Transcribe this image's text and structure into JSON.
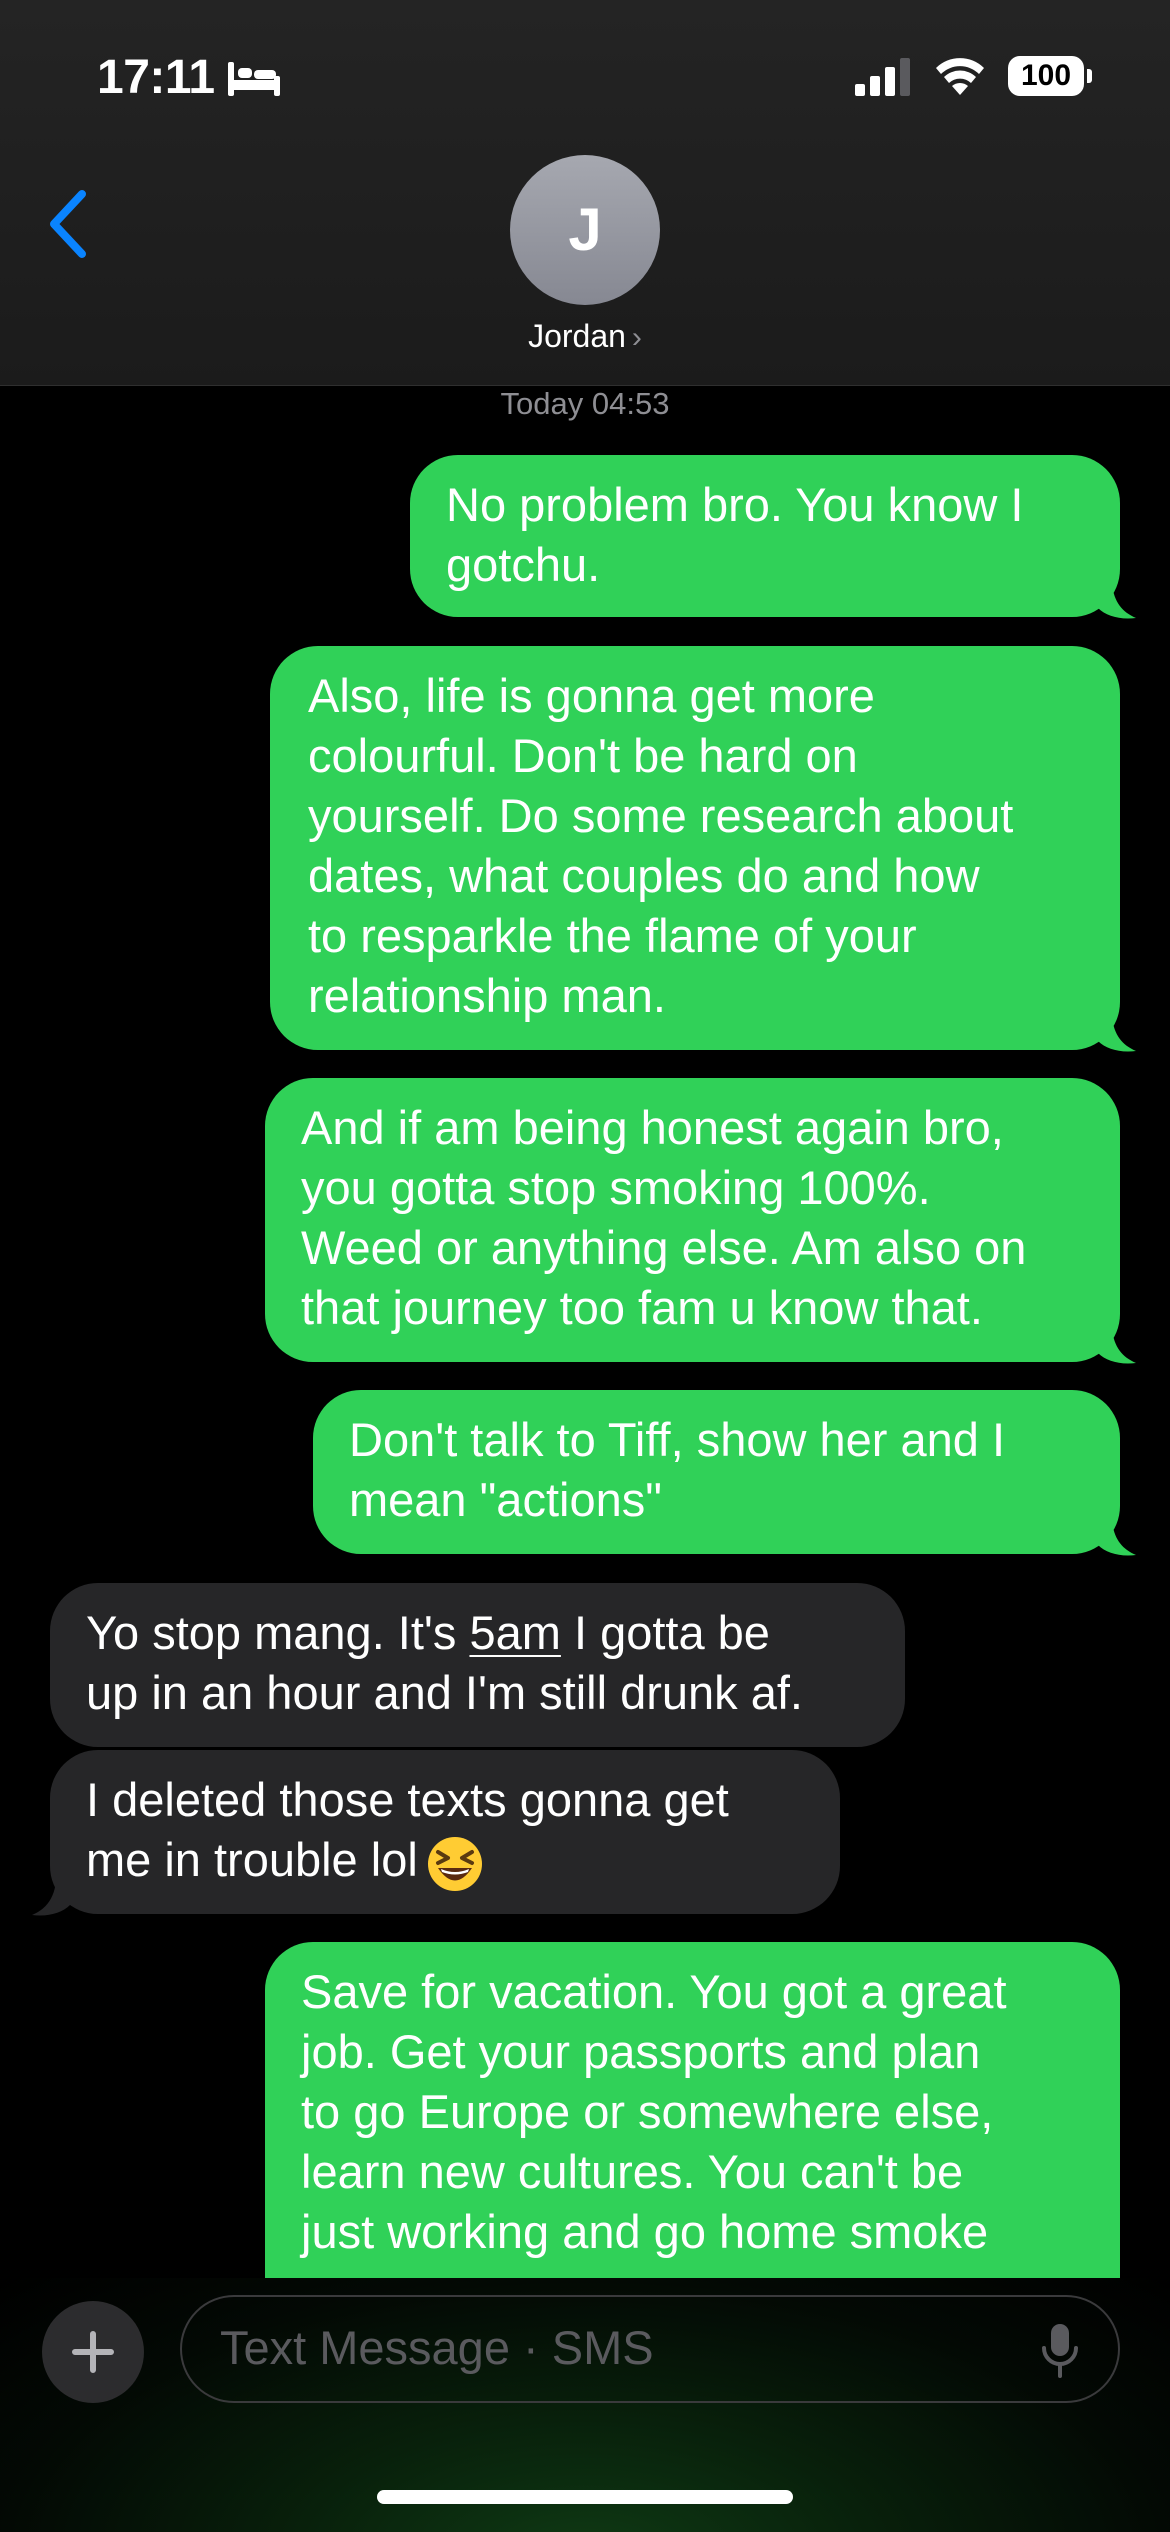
{
  "status_bar": {
    "time": "17:11",
    "battery": "100",
    "icons": [
      "bed-icon",
      "signal-icon",
      "wifi-icon",
      "battery-icon"
    ]
  },
  "header": {
    "avatar_initial": "J",
    "contact_name": "Jordan",
    "chevron": "›",
    "back_icon": "chevron-left-icon"
  },
  "conversation": {
    "timestamp": "Today 04:53",
    "messages": [
      {
        "direction": "outgoing",
        "lines": [
          "No problem bro. You know I",
          "gotchu."
        ]
      },
      {
        "direction": "outgoing",
        "lines": [
          "Also, life is gonna get more",
          "colourful. Don't be hard on",
          "yourself. Do some research about",
          "dates, what couples do and how",
          "to resparkle the flame of your",
          "relationship man."
        ]
      },
      {
        "direction": "outgoing",
        "lines": [
          "And if am being honest again bro,",
          "you gotta stop smoking 100%.",
          "Weed or anything else. Am also on",
          "that journey too fam u know that."
        ]
      },
      {
        "direction": "outgoing",
        "lines": [
          "Don't talk to Tiff, show her and I",
          "mean \"actions\""
        ]
      },
      {
        "direction": "incoming",
        "line1_before": "Yo stop mang. It's ",
        "line1_link": "5am",
        "line1_after": " I gotta be",
        "line2": "up in an hour and I'm still drunk af."
      },
      {
        "direction": "incoming",
        "lines": [
          "I deleted those texts gonna get",
          "me in trouble lol"
        ],
        "emoji": "grinning-squinting-face-emoji"
      },
      {
        "direction": "outgoing",
        "lines": [
          "Save for vacation. You got a great",
          "job.  Get your passports and plan",
          "to go Europe or somewhere else,",
          "learn new cultures. You can't be",
          "just working and go home smoke"
        ]
      }
    ]
  },
  "composer": {
    "placeholder": "Text Message · SMS",
    "plus_icon": "plus-icon",
    "mic_icon": "microphone-icon"
  },
  "colors": {
    "outgoing_bubble": "#30d158",
    "incoming_bubble": "#262628",
    "accent_blue": "#0a84ff",
    "background": "#000000"
  }
}
